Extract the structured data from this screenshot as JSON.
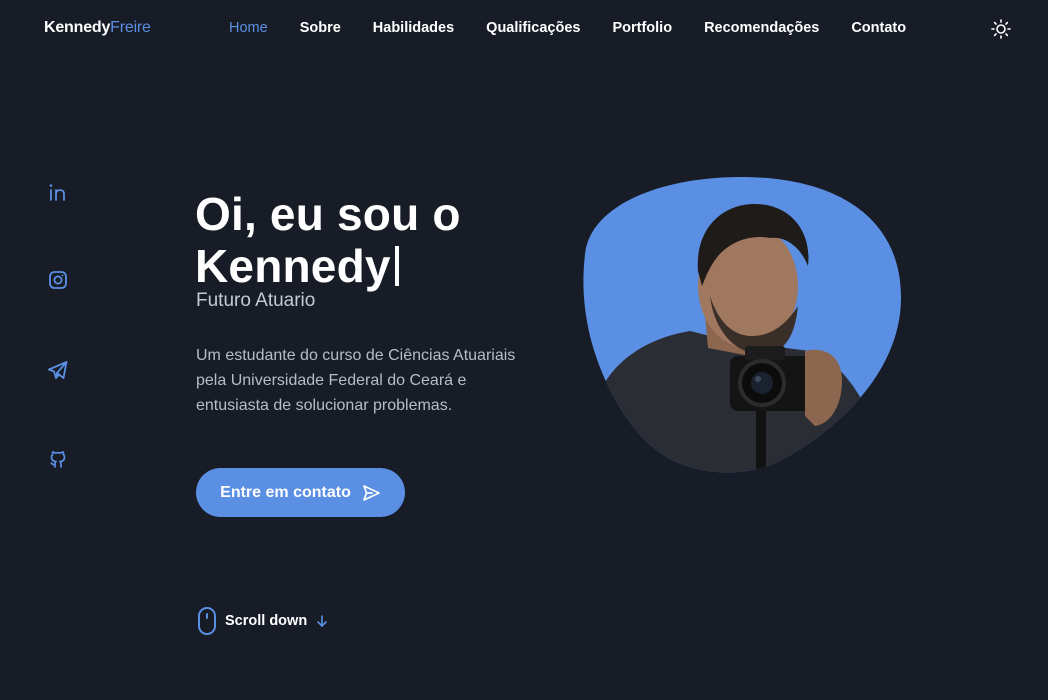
{
  "header": {
    "logo_first": "Kennedy",
    "logo_last": "Freire",
    "nav": [
      {
        "label": "Home",
        "active": true
      },
      {
        "label": "Sobre",
        "active": false
      },
      {
        "label": "Habilidades",
        "active": false
      },
      {
        "label": "Qualificações",
        "active": false
      },
      {
        "label": "Portfolio",
        "active": false
      },
      {
        "label": "Recomendações",
        "active": false
      },
      {
        "label": "Contato",
        "active": false
      }
    ],
    "theme_icon": "sun-icon"
  },
  "social": [
    {
      "icon": "linkedin-icon"
    },
    {
      "icon": "instagram-icon"
    },
    {
      "icon": "telegram-icon"
    },
    {
      "icon": "github-icon"
    }
  ],
  "hero": {
    "title_line1": "Oi, eu sou o",
    "title_line2": "Kennedy",
    "subtitle": "Futuro Atuario",
    "description": "Um estudante do curso de Ciências Atuariais pela Universidade Federal do Ceará e entusiasta de solucionar problemas.",
    "cta_label": "Entre em contato",
    "cta_icon": "send-icon",
    "scroll_label": "Scroll down",
    "scroll_icon": "mouse-icon",
    "photo_alt": "profile-photo"
  },
  "colors": {
    "background": "#181c26",
    "accent": "#5a8fe3",
    "text": "#ffffff",
    "muted": "#b8bcc7"
  }
}
